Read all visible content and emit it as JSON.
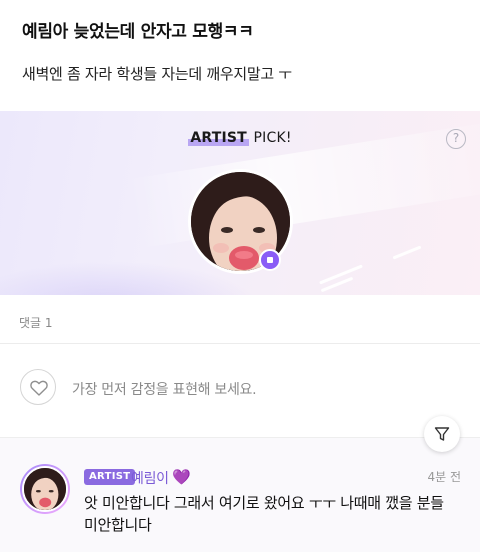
{
  "post": {
    "title": "예림아 늦었는데 안자고 모행ㅋㅋ",
    "body": "새벽엔 좀 자라 학생들 자는데 깨우지말고 ㅜ"
  },
  "artist_pick": {
    "title_artist": "ARTIST",
    "title_pick": " PICK!",
    "help_icon": "?"
  },
  "comments": {
    "count_label": "댓글 1"
  },
  "reaction": {
    "prompt": "가장 먼저 감정을 표현해 보세요."
  },
  "comment": {
    "tag": "ARTIST",
    "author": "예림이",
    "heart": "💜",
    "time": "4분 전",
    "text": "앗 미안합니다 그래서 여기로 왔어요 ㅜㅜ 나때매 깼을 분들 미안합니다"
  },
  "colors": {
    "accent": "#8a6ae0",
    "artist_badge": "#8a5cf6",
    "banner_start": "#ece8fb",
    "banner_end": "#fbeff6"
  },
  "icons": {
    "help": "question-circle-icon",
    "heart": "heart-outline-icon",
    "filter": "filter-funnel-icon",
    "badge": "artist-badge-icon"
  }
}
